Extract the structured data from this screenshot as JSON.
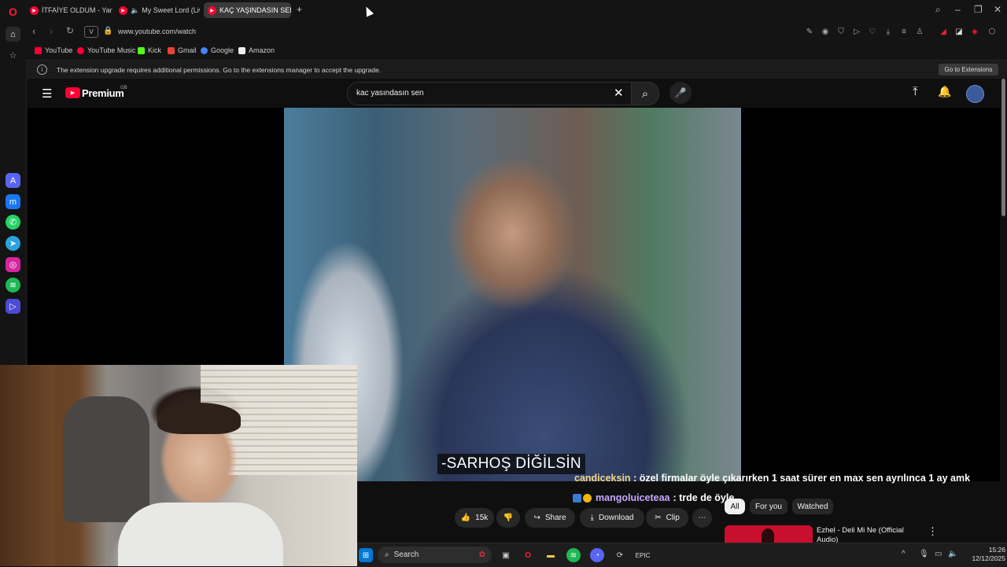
{
  "tabs": [
    {
      "label": "İTFAİYE OLDUM - Yanan v",
      "favicon_color": "#ff0033"
    },
    {
      "label": "My Sweet Lord (Live)",
      "favicon_color": "#ff0033"
    },
    {
      "label": "KAÇ YAŞINDASIN SEN? -",
      "favicon_color": "#ff0033",
      "active": true
    }
  ],
  "address": {
    "url": "www.youtube.com/watch",
    "site_chip": "V"
  },
  "bookmarks": [
    {
      "label": "YouTube",
      "color": "#ff0033"
    },
    {
      "label": "YouTube Music",
      "color": "#ff0033"
    },
    {
      "label": "Kick",
      "color": "#53fc18"
    },
    {
      "label": "Gmail",
      "color": "#ea4335"
    },
    {
      "label": "Google",
      "color": "#4285f4"
    },
    {
      "label": "Amazon",
      "color": "#eeeeee"
    }
  ],
  "infobar": {
    "message": "The extension upgrade requires additional permissions. Go to the extensions manager to accept the upgrade.",
    "button": "Go to Extensions"
  },
  "youtube": {
    "logo": "Premium",
    "region": "GB",
    "search_value": "kac yasındasın sen"
  },
  "video": {
    "subtitle": "-SARHOŞ DİĞİLSİN"
  },
  "chat": [
    {
      "user": "candiceksin",
      "message": ": özel firmalar öyle çıkarırken 1 saat sürer en max sen ayrılınca 1 ay amk",
      "color": "#f2d98c"
    },
    {
      "user": "mangoluiceteaa",
      "message": ": trde de öyle",
      "color": "#c9a7ff"
    }
  ],
  "actions": {
    "likes": "15k",
    "share": "Share",
    "download": "Download",
    "clip": "Clip"
  },
  "filter_chips": [
    "All",
    "For you",
    "Watched"
  ],
  "recommended": {
    "title": "Ezhel - Deli Mi Ne (Official",
    "title_line2": "Audio)"
  },
  "taskbar": {
    "search": "Search",
    "time": "15:26",
    "date": "12/12/2025"
  },
  "colors": {
    "youtube_red": "#ff0033",
    "opera_red": "#ff1b2d"
  }
}
